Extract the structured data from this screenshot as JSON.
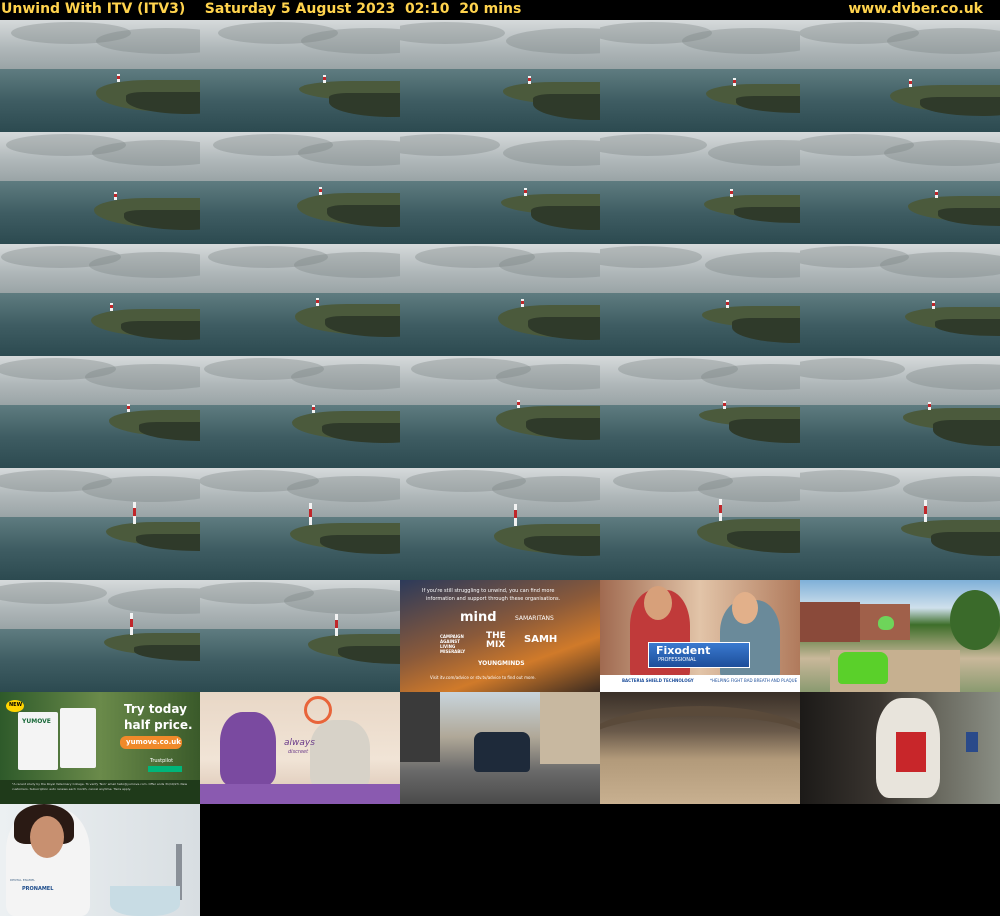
{
  "header": {
    "title": "Unwind With ITV (ITV3)    Saturday 5 August 2023  02:10  20 mins",
    "site": "www.dvber.co.uk"
  },
  "colors": {
    "header_text": "#ffd34d",
    "background": "#000000"
  },
  "ads": {
    "mental_health": {
      "line1": "If you're still struggling to unwind, you can find more",
      "line2": "information and support through these organisations.",
      "mind": "mind",
      "samaritans": "SAMARITANS",
      "calm": "CAMPAIGN AGAINST LIVING MISERABLY",
      "mix": "THE MIX",
      "samh": "SAMH",
      "youngminds": "YOUNGMINDS",
      "footer": "Visit itv.com/advice or stv.tv/advice to find out more."
    },
    "fixodent": {
      "brand": "Fixodent",
      "sub": "PROFESSIONAL",
      "tagline": "BACTERIA SHIELD TECHNOLOGY",
      "claim": "*HELPING FIGHT BAD BREATH AND PLAQUE"
    },
    "yumove": {
      "badge": "NEW",
      "brand": "YUMOVE",
      "headline1": "Try today",
      "headline2": "half price.",
      "url": "yumove.co.uk",
      "trust": "Trustpilot",
      "fineprint": "*A recent study by the Royal Veterinary College. To verify 'No1' email hello@yumove.com. Offer ends 31/10/23. New customers. Subscription auto renews each month, cancel anytime. T&Cs apply."
    },
    "always": {
      "brand": "always",
      "sub": "discreet"
    },
    "proenamel": {
      "brand": "PRONAMEL",
      "label": "DENTAL ENAMEL"
    }
  }
}
